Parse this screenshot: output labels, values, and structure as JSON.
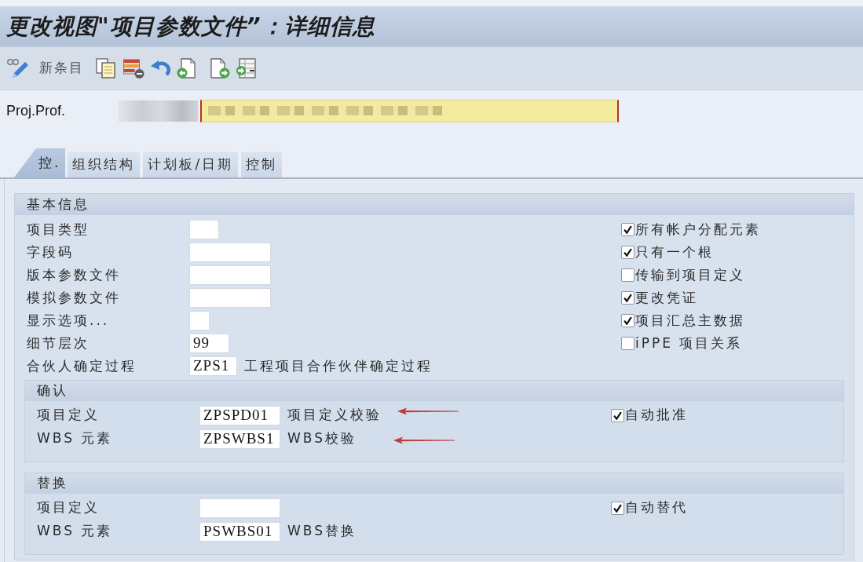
{
  "window": {
    "title": "更改视图\"项目参数文件”：详细信息"
  },
  "toolbar": {
    "new_entry": "新条目"
  },
  "header": {
    "label": "Proj.Prof."
  },
  "tabs": [
    {
      "label": "控.",
      "selected": true
    },
    {
      "label": "组织结构",
      "selected": false
    },
    {
      "label": "计划板/日期",
      "selected": false
    },
    {
      "label": "控制",
      "selected": false
    }
  ],
  "basic_info": {
    "title": "基本信息",
    "fields": [
      {
        "label": "项目类型"
      },
      {
        "label": "字段码"
      },
      {
        "label": "版本参数文件"
      },
      {
        "label": "模拟参数文件"
      },
      {
        "label": "显示选项..."
      },
      {
        "label": "细节层次",
        "value": "99"
      },
      {
        "label": "合伙人确定过程",
        "value": "ZPS1",
        "description": "工程项目合作伙伴确定过程"
      }
    ],
    "checkboxes": [
      {
        "label": "所有帐户分配元素",
        "checked": true
      },
      {
        "label": "只有一个根",
        "checked": true
      },
      {
        "label": "传输到项目定义",
        "checked": false
      },
      {
        "label": "更改凭证",
        "checked": true
      },
      {
        "label": "项目汇总主数据",
        "checked": true
      },
      {
        "label": "iPPE 项目关系",
        "checked": false
      }
    ]
  },
  "validation": {
    "title": "确认",
    "rows": [
      {
        "label": "项目定义",
        "value": "ZPSPD01",
        "description": "项目定义校验"
      },
      {
        "label": "WBS 元素",
        "value": "ZPSWBS1",
        "description": "WBS校验"
      }
    ],
    "checkbox": {
      "label": "自动批准",
      "checked": true
    }
  },
  "substitution": {
    "title": "替换",
    "rows": [
      {
        "label": "项目定义"
      },
      {
        "label": "WBS 元素",
        "value": "PSWBS01",
        "description": "WBS替换"
      }
    ],
    "checkbox": {
      "label": "自动替代",
      "checked": true
    }
  }
}
